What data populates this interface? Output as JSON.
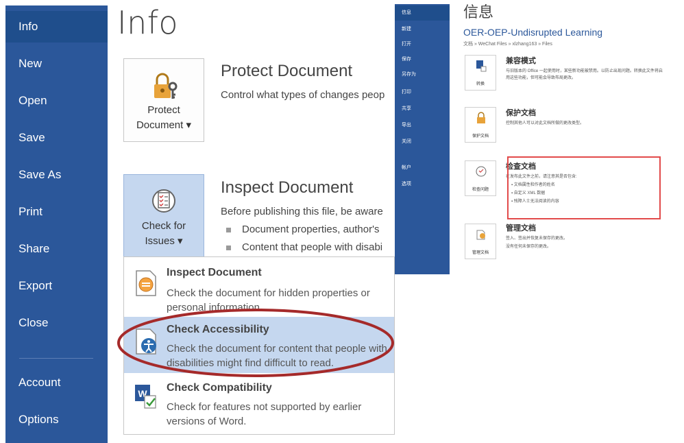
{
  "nav": {
    "items": [
      "Info",
      "New",
      "Open",
      "Save",
      "Save As",
      "Print",
      "Share",
      "Export",
      "Close"
    ],
    "bottom_items": [
      "Account",
      "Options"
    ],
    "active": "Info"
  },
  "page": {
    "title": "Info"
  },
  "protect": {
    "button_line1": "Protect",
    "button_line2": "Document",
    "title": "Protect Document",
    "desc": "Control what types of changes peop"
  },
  "inspect": {
    "button_line1": "Check for",
    "button_line2": "Issues",
    "title": "Inspect Document",
    "desc": "Before publishing this file, be aware",
    "bullets": [
      "Document properties, author's",
      "Content that people with disabi"
    ]
  },
  "dropdown": {
    "items": [
      {
        "title": "Inspect Document",
        "desc": "Check the document for hidden properties or personal information."
      },
      {
        "title": "Check Accessibility",
        "desc": "Check the document for content that people with disabilities might find difficult to read."
      },
      {
        "title": "Check Compatibility",
        "desc": "Check for features not supported by earlier versions of Word."
      }
    ]
  },
  "cn": {
    "nav": [
      "信息",
      "新建",
      "打开",
      "保存",
      "另存为",
      "打印",
      "共享",
      "导出",
      "关闭"
    ],
    "nav_bottom": [
      "帐户",
      "选项"
    ],
    "title": "信息",
    "doc_name": "OER-OEP-Undisrupted Learning",
    "path": "文档 » WeChat Files » xlzhang163 » Files",
    "sections": [
      {
        "tile": "转换",
        "title": "兼容模式",
        "lines": [
          "与旧版本的 Office 一起使用时，某些新功能被禁用。以防止出现问题。转换此文件将启",
          "用这些功能，但可能会导致布局更改。"
        ]
      },
      {
        "tile": "保护文档",
        "title": "保护文档",
        "lines": [
          "控制其他人可以对此文档所做的更改类型。"
        ]
      },
      {
        "tile": "检查问题",
        "title": "检查文档",
        "lines": [
          "在发布此文件之前，请注意其是否包含:",
          "文档属性和作者的姓名",
          "自定义 XML 数据",
          "残障人士无法阅读的内容"
        ]
      },
      {
        "tile": "管理文档",
        "title": "管理文档",
        "lines": [
          "签入、签出并恢复未保存的更改。",
          "没有任何未保存的更改。"
        ]
      }
    ]
  },
  "colors": {
    "nav_bg": "#2b579a",
    "highlight": "#c5d7ef",
    "annotation": "#a52a2a",
    "red_box": "#e24a4a"
  }
}
